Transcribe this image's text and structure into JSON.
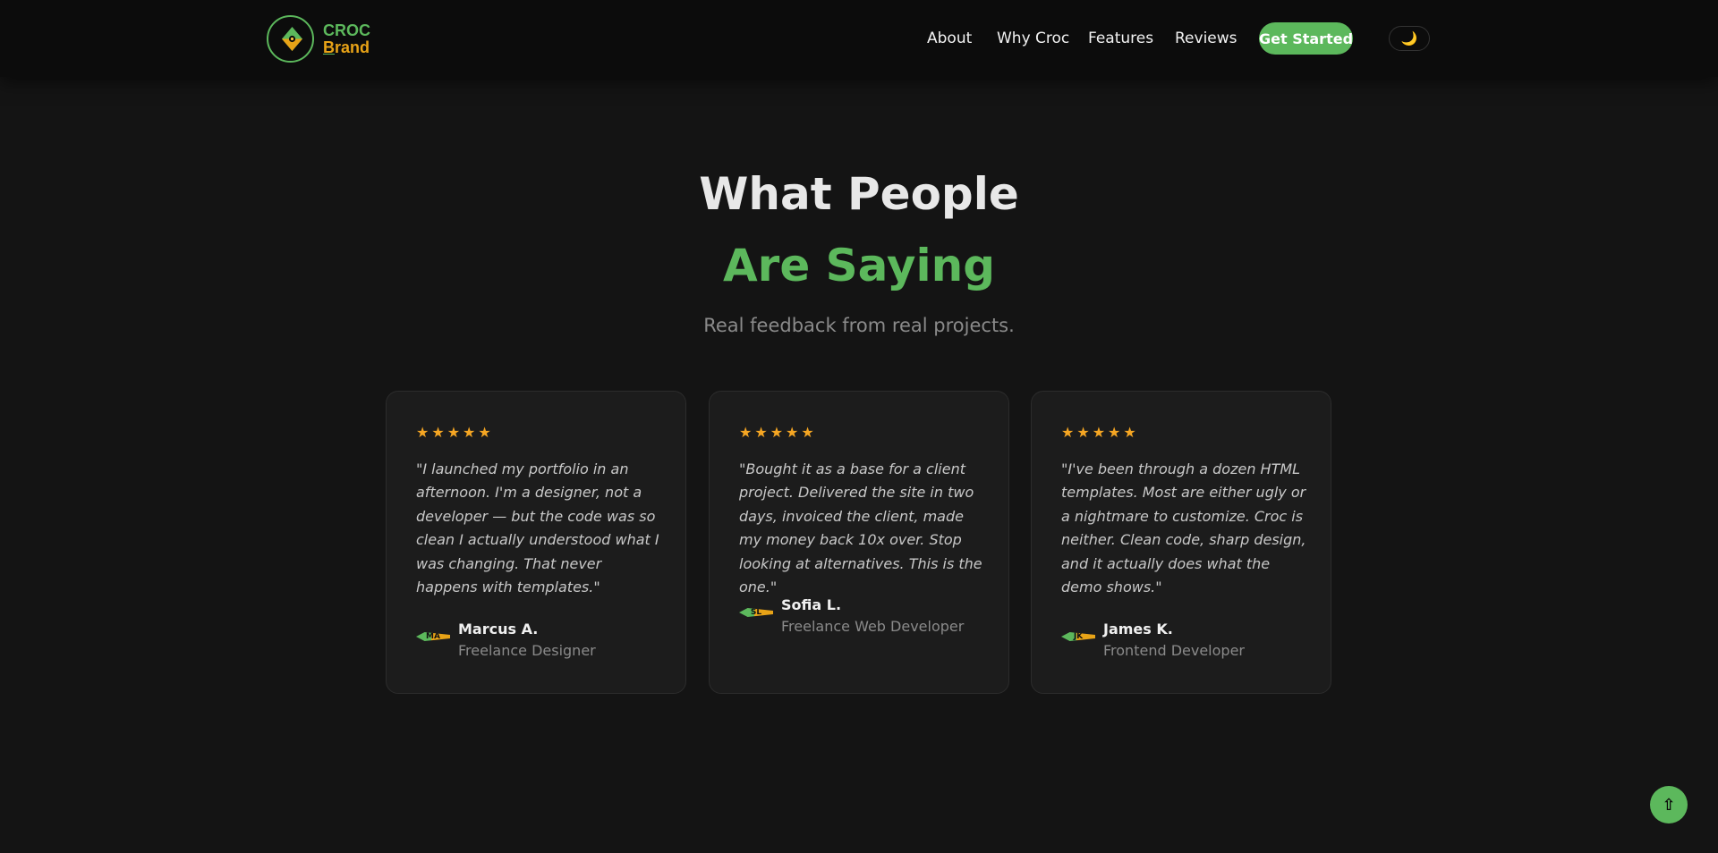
{
  "brand": {
    "line1": "CROC",
    "line2_underlined": "B",
    "line2_rest": "rand"
  },
  "nav": {
    "links": [
      "About",
      "Why Croc",
      "Features",
      "Reviews"
    ],
    "cta": "Get Started",
    "theme_icon": "moon-icon"
  },
  "section": {
    "title_line1": "What People",
    "title_line2": "Are Saying",
    "subtitle": "Real feedback from real projects."
  },
  "reviews": [
    {
      "stars": "★★★★★",
      "rating": 5,
      "quote": "\"I launched my portfolio in an afternoon. I'm a designer, not a developer — but the code was so clean I actually understood what I was changing. That never happens with templates.\"",
      "initials": "MA",
      "name": "Marcus A.",
      "role": "Freelance Designer"
    },
    {
      "stars": "★★★★★",
      "rating": 5,
      "quote": "\"Bought it as a base for a client project. Delivered the site in two days, invoiced the client, made my money back 10x over. Stop looking at alternatives. This is the one.\"",
      "initials": "SL",
      "name": "Sofia L.",
      "role": "Freelance Web Developer"
    },
    {
      "stars": "★★★★★",
      "rating": 5,
      "quote": "\"I've been through a dozen HTML templates. Most are either ugly or a nightmare to customize. Croc is neither. Clean code, sharp design, and it actually does what the demo shows.\"",
      "initials": "JK",
      "name": "James K.",
      "role": "Frontend Developer"
    }
  ],
  "back_to_top": "⇧",
  "colors": {
    "accent_green": "#5cb85c",
    "accent_gold": "#e8a317",
    "star": "#f5a623",
    "background": "#141414"
  }
}
